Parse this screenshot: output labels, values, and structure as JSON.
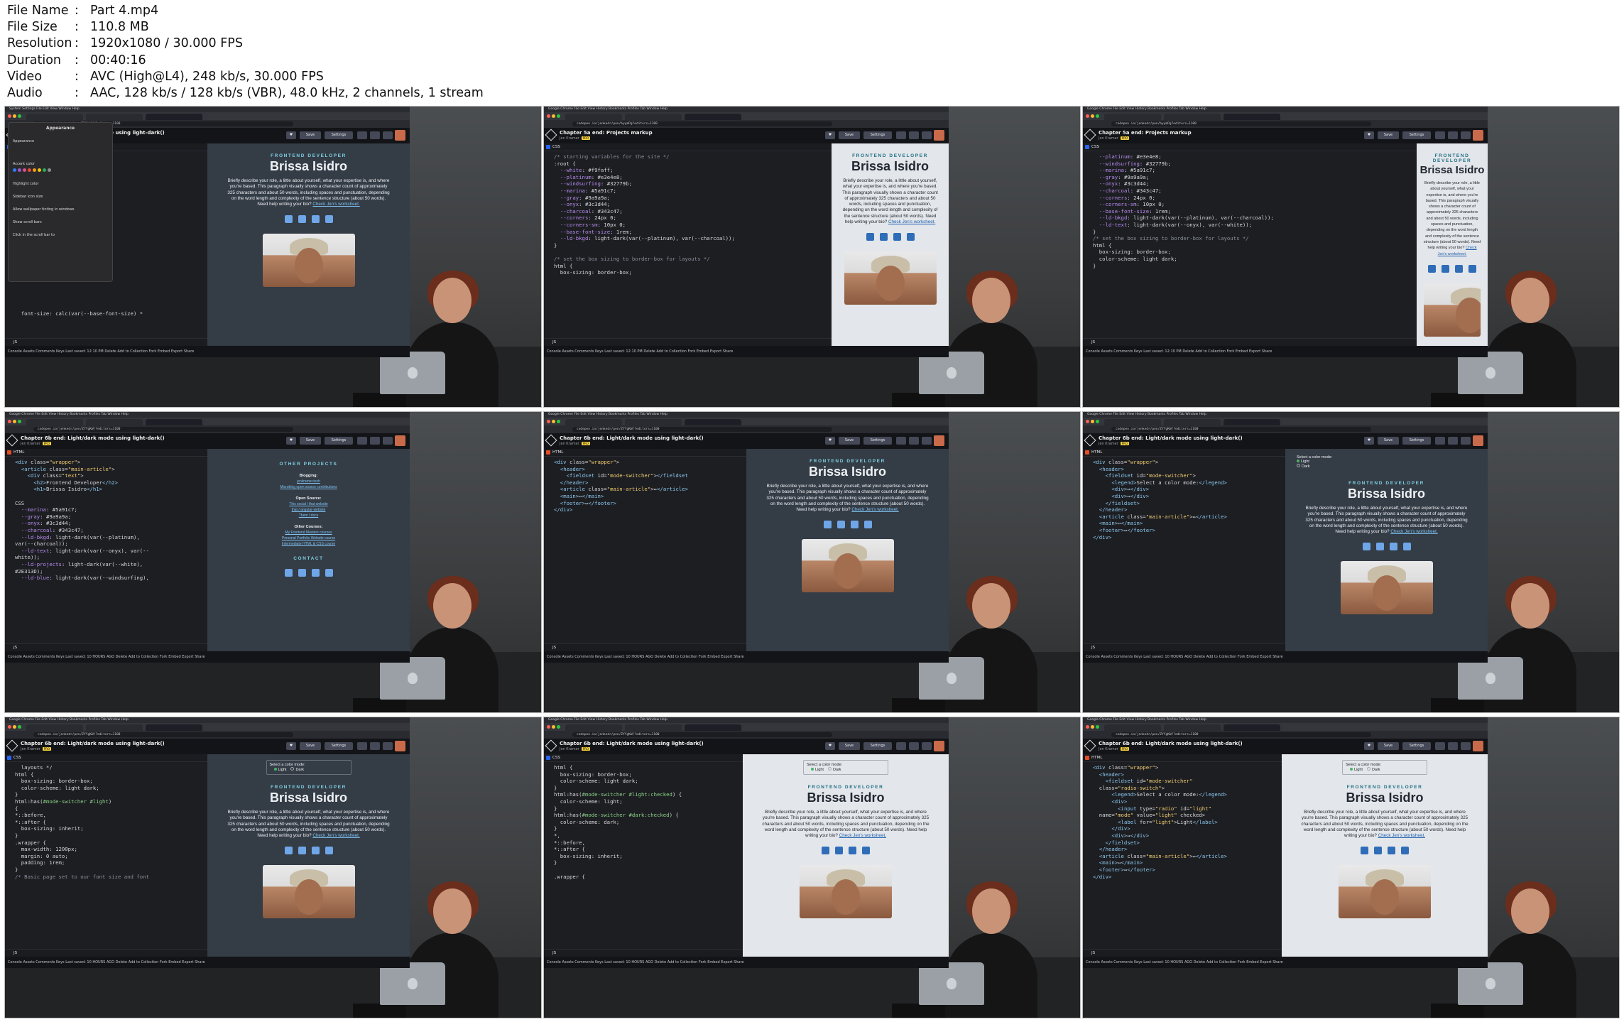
{
  "file_info": [
    {
      "key": "File Name",
      "value": "Part 4.mp4"
    },
    {
      "key": "File Size",
      "value": "110.8 MB"
    },
    {
      "key": "Resolution",
      "value": "1920x1080 / 30.000 FPS"
    },
    {
      "key": "Duration",
      "value": "00:40:16"
    },
    {
      "key": "Video",
      "value": "AVC (High@L4), 248 kb/s, 30.000 FPS"
    },
    {
      "key": "Audio",
      "value": "AAC, 128 kb/s / 128 kb/s (VBR), 48.0 kHz, 2 channels, 1 stream"
    }
  ],
  "separator": ":",
  "profile": {
    "kicker": "FRONTEND DEVELOPER",
    "name": "Brissa Isidro",
    "bio": "Briefly describe your role, a little about yourself, what your expertise is, and where you're based. This paragraph visually shows a character count of approximately 325 characters and about 50 words, including spaces and punctuation, depending on the word length and complexity of the sentence structure (about 50 words). Need help writing your bio?",
    "bio_link": "Check Jen's worksheet."
  },
  "switcher": {
    "legend": "Select a color mode:",
    "light": "Light",
    "dark": "Dark"
  },
  "thumbs": [
    {
      "title": "Chapter 6b end: Light/dark mode using light-dark()",
      "author": "Jen Kramer",
      "url": "codepen.io/jenkedr/pen/ZYYgKW/?editors=1100",
      "menubar": "System Settings   File   Edit   View   Window   Help",
      "editor_label": "CSS",
      "code": "\n\n\n\n\n\n\n\n\n\n\n\n\n\n\n  width\n\n\n\n\n\n\n\n  font-size: calc(var(--base-font-size) *",
      "preview": "dark",
      "show_switcher": false,
      "overlay": true,
      "overlay_title": "Appearance",
      "overlay_items": [
        "Appearance",
        "Accent color",
        "Highlight color",
        "Sidebar icon size",
        "Allow wallpaper tinting in windows",
        "Show scroll bars",
        "Click in the scroll bar to"
      ],
      "status": "Console   Assets   Comments   Keys                        Last saved: 12:10 PM    Delete   Add to Collection   Fork   Embed   Export   Share"
    },
    {
      "title": "Chapter 5a end: Projects markup",
      "author": "Jen Kramer",
      "url": "codepen.io/jenkedr/pen/byymPg?editors=1100",
      "menubar": "Google Chrome   File   Edit   View   History   Bookmarks   Profiles   Tab   Window   Help",
      "editor_label": "CSS",
      "code": "<span class=\"c\">/* starting variables for the site */</span>\n:root {\n  <span class=\"p\">--white</span>: #f9faff;\n  <span class=\"p\">--platinum</span>: #e3e4e8;\n  <span class=\"p\">--windsurfing</span>: #32779b;\n  <span class=\"p\">--marina</span>: #5a91c7;\n  <span class=\"p\">--gray</span>: #9a9a9a;\n  <span class=\"p\">--onyx</span>: #3c3d44;\n  <span class=\"p\">--charcoal</span>: #343c47;\n  <span class=\"p\">--corners</span>: 24px 0;\n  <span class=\"p\">--corners-sm</span>: 10px 0;\n  <span class=\"p\">--base-font-size</span>: 1rem;\n  <span class=\"p\">--ld-bkgd</span>: light-dark(var(--platinum), var(--charcoal));\n}\n\n<span class=\"c\">/* set the box sizing to border-box for layouts */</span>\nhtml {\n  box-sizing: border-box;",
      "preview": "light",
      "show_switcher": false,
      "overlay": false,
      "status": "Console   Assets   Comments   Keys                        Last saved: 12:10 PM    Delete   Add to Collection   Fork   Embed   Export   Share"
    },
    {
      "title": "Chapter 5a end: Projects markup",
      "author": "Jen Kramer",
      "url": "codepen.io/jenkedr/pen/byymPg?editors=1100",
      "menubar": "Google Chrome   File   Edit   View   History   Bookmarks   Profiles   Tab   Window   Help",
      "editor_label": "CSS",
      "code": "  <span class=\"p\">--platinum</span>: #e3e4e8;\n  <span class=\"p\">--windsurfing</span>: #32779b;\n  <span class=\"p\">--marina</span>: #5a91c7;\n  <span class=\"p\">--gray</span>: #9a9a9a;\n  <span class=\"p\">--onyx</span>: #3c3d44;\n  <span class=\"p\">--charcoal</span>: #343c47;\n  <span class=\"p\">--corners</span>: 24px 0;\n  <span class=\"p\">--corners-sm</span>: 10px 0;\n  <span class=\"p\">--base-font-size</span>: 1rem;\n  <span class=\"p\">--ld-bkgd</span>: light-dark(var(--platinum), var(--charcoal));\n  <span class=\"p\">--ld-text</span>: light-dark(var(--onyx), var(--white));\n}\n<span class=\"c\">/* set the box sizing to border-box for layouts */</span>\nhtml {\n  box-sizing: border-box;\n  color-scheme: light dark;\n}",
      "preview": "light",
      "show_switcher": false,
      "overlay": false,
      "status": "Console   Assets   Comments   Keys                        Last saved: 12:10 PM    Delete   Add to Collection   Fork   Embed   Export   Share"
    },
    {
      "title": "Chapter 6b end: Light/dark mode using light-dark()",
      "author": "Jen Kramer",
      "url": "codepen.io/jenkedr/pen/ZYYgKW/?editors=1100",
      "menubar": "Google Chrome   File   Edit   View   History   Bookmarks   Profiles   Tab   Window   Help",
      "editor_label": "HTML",
      "code": "<span class=\"t\">&lt;div</span> class=<span class=\"s\">\"wrapper\"</span>&gt;\n  <span class=\"t\">&lt;article</span> class=<span class=\"s\">\"main-article\"</span>&gt;\n    <span class=\"t\">&lt;div</span> class=<span class=\"s\">\"text\"</span>&gt;\n      <span class=\"t\">&lt;h2&gt;</span>Frontend Developer<span class=\"t\">&lt;/h2&gt;</span>\n      <span class=\"t\">&lt;h1&gt;</span>Brissa Isidro<span class=\"t\">&lt;/h1&gt;</span>\n\nCSS\n  <span class=\"p\">--marina</span>: #5a91c7;\n  <span class=\"p\">--gray</span>: #9a9a9a;\n  <span class=\"p\">--onyx</span>: #3c3d44;\n  <span class=\"p\">--charcoal</span>: #343c47;\n  <span class=\"p\">--ld-bkgd</span>: light-dark(var(--platinum),\nvar(--charcoal));\n  <span class=\"p\">--ld-text</span>: light-dark(var(--onyx), var(--\nwhite));\n  <span class=\"p\">--ld-projects</span>: light-dark(var(--white),\n#2E313D);\n  <span class=\"p\">--ld-blue</span>: light-dark(var(--windsurfing),",
      "preview": "dark",
      "show_switcher": false,
      "overlay": false,
      "projects": true,
      "projects_data": {
        "heading": "OTHER PROJECTS",
        "blocks": [
          {
            "title": "Blogging:",
            "links": [
              "jenkramer.tech",
              "Microblog open source contributions"
            ]
          },
          {
            "title": "Open Source:",
            "links": [
              "This social / that website",
              "that / angular-website",
              "Them / docs"
            ]
          },
          {
            "title": "Other Courses:",
            "links": [
              "My Frontend Masters courses",
              "Personal Portfolio Website course",
              "Intermediate HTML & CSS course"
            ]
          }
        ],
        "contact": "CONTACT"
      },
      "status": "Console   Assets   Comments   Keys                        Last saved: 10 HOURS AGO    Delete   Add to Collection   Fork   Embed   Export   Share"
    },
    {
      "title": "Chapter 6b end: Light/dark mode using light-dark()",
      "author": "Jen Kramer",
      "url": "codepen.io/jenkedr/pen/ZYYgKW/?editors=1100",
      "menubar": "Google Chrome   File   Edit   View   History   Bookmarks   Profiles   Tab   Window   Help",
      "editor_label": "HTML",
      "code": "<span class=\"t\">&lt;div</span> class=<span class=\"s\">\"wrapper\"</span>&gt;\n  <span class=\"t\">&lt;header&gt;</span>\n    <span class=\"t\">&lt;fieldset</span> id=<span class=\"s\">\"mode-switcher\"</span>&gt;<span class=\"t\">&lt;/fieldset</span>\n  <span class=\"t\">&lt;/header&gt;</span>\n  <span class=\"t\">&lt;article</span> class=<span class=\"s\">\"main-article\"</span>&gt;↔<span class=\"t\">&lt;/article&gt;</span>\n  <span class=\"t\">&lt;main&gt;</span>↔<span class=\"t\">&lt;/main&gt;</span>\n  <span class=\"t\">&lt;footer&gt;</span>↔<span class=\"t\">&lt;/footer&gt;</span>\n<span class=\"t\">&lt;/div&gt;</span>",
      "preview": "dark",
      "show_switcher": false,
      "overlay": false,
      "status": "Console   Assets   Comments   Keys                        Last saved: 10 HOURS AGO    Delete   Add to Collection   Fork   Embed   Export   Share"
    },
    {
      "title": "Chapter 6b end: Light/dark mode using light-dark()",
      "author": "Jen Kramer",
      "url": "codepen.io/jenkedr/pen/ZYYgKW/?editors=1100",
      "menubar": "Google Chrome   File   Edit   View   History   Bookmarks   Profiles   Tab   Window   Help",
      "editor_label": "HTML",
      "code": "<span class=\"t\">&lt;div</span> class=<span class=\"s\">\"wrapper\"</span>&gt;\n  <span class=\"t\">&lt;header&gt;</span>\n    <span class=\"t\">&lt;fieldset</span> id=<span class=\"s\">\"mode-switcher\"</span>&gt;\n      <span class=\"t\">&lt;legend&gt;</span>Select a color mode:<span class=\"t\">&lt;/legend&gt;</span>\n      <span class=\"t\">&lt;div&gt;</span>↔<span class=\"t\">&lt;/div&gt;</span>\n      <span class=\"t\">&lt;div&gt;</span>↔<span class=\"t\">&lt;/div&gt;</span>\n    <span class=\"t\">&lt;/fieldset&gt;</span>\n  <span class=\"t\">&lt;/header&gt;</span>\n  <span class=\"t\">&lt;article</span> class=<span class=\"s\">\"main-article\"</span>&gt;↔<span class=\"t\">&lt;/article&gt;</span>\n  <span class=\"t\">&lt;main&gt;</span>↔<span class=\"t\">&lt;/main&gt;</span>\n  <span class=\"t\">&lt;footer&gt;</span>↔<span class=\"t\">&lt;/footer&gt;</span>\n<span class=\"t\">&lt;/div&gt;</span>",
      "preview": "dark",
      "show_switcher": true,
      "switcher_stacked": true,
      "overlay": false,
      "status": "Console   Assets   Comments   Keys                        Last saved: 10 HOURS AGO    Delete   Add to Collection   Fork   Embed   Export   Share"
    },
    {
      "title": "Chapter 6b end: Light/dark mode using light-dark()",
      "author": "Jen Kramer",
      "url": "codepen.io/jenkedr/pen/ZYYgKW/?editors=1100",
      "menubar": "Google Chrome   File   Edit   View   History   Bookmarks   Profiles   Tab   Window   Help",
      "editor_label": "CSS",
      "code": "  layouts */\nhtml {\n  box-sizing: border-box;\n  color-scheme: light dark;\n}\nhtml:has(<span class=\"g\">#mode-switcher #light</span>)\n{\n*::before,\n*::after {\n  box-sizing: inherit;\n}\n.wrapper {\n  max-width: 1200px;\n  margin: 0 auto;\n  padding: 1rem;\n}\n<span class=\"c\">/* Basic page set to our font size and font</span>",
      "preview": "dark",
      "show_switcher": true,
      "switcher_stacked": false,
      "overlay": false,
      "status": "Console   Assets   Comments   Keys                        Last saved: 10 HOURS AGO    Delete   Add to Collection   Fork   Embed   Export   Share"
    },
    {
      "title": "Chapter 6b end: Light/dark mode using light-dark()",
      "author": "Jen Kramer",
      "url": "codepen.io/jenkedr/pen/ZYYgKW/?editors=1100",
      "menubar": "Google Chrome   File   Edit   View   History   Bookmarks   Profiles   Tab   Window   Help",
      "editor_label": "CSS",
      "code": "html {\n  box-sizing: border-box;\n  color-scheme: light dark;\n}\nhtml:has(<span class=\"g\">#mode-switcher #light:checked</span>) {\n  color-scheme: light;\n}\nhtml:has(<span class=\"g\">#mode-switcher #dark:checked</span>) {\n  color-scheme: dark;\n}\n*,\n*::before,\n*::after {\n  box-sizing: inherit;\n}\n\n.wrapper {",
      "preview": "light",
      "show_switcher": true,
      "switcher_stacked": false,
      "overlay": false,
      "status": "Console   Assets   Comments   Keys                        Last saved: 10 HOURS AGO    Delete   Add to Collection   Fork   Embed   Export   Share"
    },
    {
      "title": "Chapter 6b end: Light/dark mode using light-dark()",
      "author": "Jen Kramer",
      "url": "codepen.io/jenkedr/pen/ZYYgKW/?editors=1100",
      "menubar": "Google Chrome   File   Edit   View   History   Bookmarks   Profiles   Tab   Window   Help",
      "editor_label": "HTML",
      "code": "<span class=\"t\">&lt;div</span> class=<span class=\"s\">\"wrapper\"</span>&gt;\n  <span class=\"t\">&lt;header&gt;</span>\n    <span class=\"t\">&lt;fieldset</span> id=<span class=\"s\">\"mode-switcher\"</span>\n  class=<span class=\"s\">\"radio-switch\"</span>&gt;\n      <span class=\"t\">&lt;legend&gt;</span>Select a color mode:<span class=\"t\">&lt;/legend&gt;</span>\n      <span class=\"t\">&lt;div&gt;</span>\n        <span class=\"t\">&lt;input</span> type=<span class=\"s\">\"radio\"</span> id=<span class=\"s\">\"light\"</span>\n  name=<span class=\"s\">\"mode\"</span> value=<span class=\"s\">\"light\"</span> checked&gt;\n        <span class=\"t\">&lt;label</span> for=<span class=\"s\">\"light\"</span>&gt;Light<span class=\"t\">&lt;/label&gt;</span>\n      <span class=\"t\">&lt;/div&gt;</span>\n      <span class=\"t\">&lt;div&gt;</span>↔<span class=\"t\">&lt;/div&gt;</span>\n    <span class=\"t\">&lt;/fieldset&gt;</span>\n  <span class=\"t\">&lt;/header&gt;</span>\n  <span class=\"t\">&lt;article</span> class=<span class=\"s\">\"main-article\"</span>&gt;↔<span class=\"t\">&lt;/article&gt;</span>\n  <span class=\"t\">&lt;main&gt;</span>↔<span class=\"t\">&lt;/main&gt;</span>\n  <span class=\"t\">&lt;footer&gt;</span>↔<span class=\"t\">&lt;/footer&gt;</span>\n<span class=\"t\">&lt;/div&gt;</span>",
      "preview": "light",
      "show_switcher": true,
      "switcher_stacked": false,
      "overlay": false,
      "status": "Console   Assets   Comments   Keys                        Last saved: 10 HOURS AGO    Delete   Add to Collection   Fork   Embed   Export   Share"
    }
  ],
  "buttons": {
    "save": "Save",
    "settings": "Settings"
  }
}
